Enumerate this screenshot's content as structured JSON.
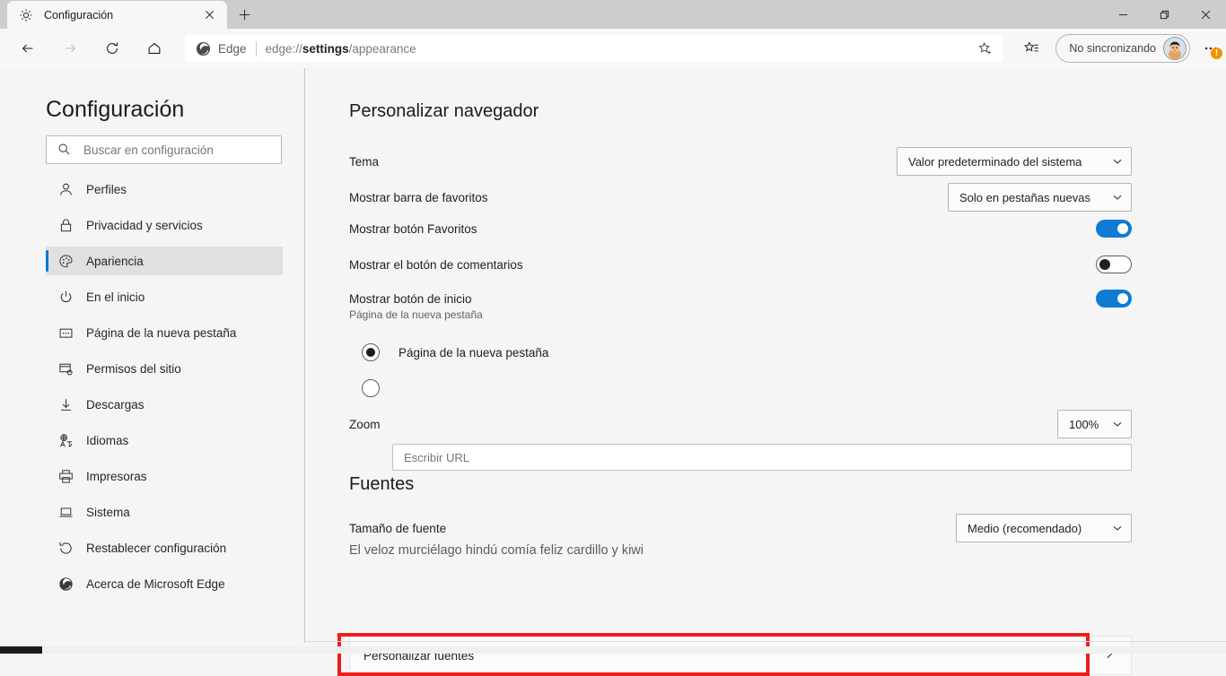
{
  "window": {
    "minimize_label": "Minimizar",
    "restore_label": "Restaurar",
    "close_label": "Cerrar"
  },
  "tabstrip": {
    "tab": {
      "title": "Configuración",
      "favicon": "gear-icon",
      "close_label": "×"
    },
    "new_tab_label": "+"
  },
  "toolbar": {
    "back_label": "Atrás",
    "forward_label": "Adelante",
    "refresh_label": "Actualizar",
    "home_label": "Inicio",
    "omnibox": {
      "site_label": "Edge",
      "url_prefix": "edge://",
      "url_bold": "settings",
      "url_suffix": "/appearance",
      "full_url": "edge://settings/appearance",
      "favorite_icon": "star-add-icon"
    },
    "collections_icon": "collections-icon",
    "profile": {
      "label": "No sincronizando",
      "avatar": "user-avatar"
    },
    "more": {
      "icon": "ellipsis-icon",
      "badge": "!"
    }
  },
  "sidebar": {
    "title": "Configuración",
    "search": {
      "placeholder": "Buscar en configuración",
      "value": "",
      "icon": "search-icon"
    },
    "items": [
      {
        "label": "Perfiles",
        "icon": "person-icon",
        "selected": false
      },
      {
        "label": "Privacidad y servicios",
        "icon": "lock-icon",
        "selected": false
      },
      {
        "label": "Apariencia",
        "icon": "palette-icon",
        "selected": true
      },
      {
        "label": "En el inicio",
        "icon": "power-icon",
        "selected": false
      },
      {
        "label": "Página de la nueva pestaña",
        "icon": "newtab-icon",
        "selected": false
      },
      {
        "label": "Permisos del sitio",
        "icon": "site-permissions-icon",
        "selected": false
      },
      {
        "label": "Descargas",
        "icon": "download-icon",
        "selected": false
      },
      {
        "label": "Idiomas",
        "icon": "language-icon",
        "selected": false
      },
      {
        "label": "Impresoras",
        "icon": "printer-icon",
        "selected": false
      },
      {
        "label": "Sistema",
        "icon": "laptop-icon",
        "selected": false
      },
      {
        "label": "Restablecer configuración",
        "icon": "reset-icon",
        "selected": false
      },
      {
        "label": "Acerca de Microsoft Edge",
        "icon": "edge-icon",
        "selected": false
      }
    ]
  },
  "main": {
    "section_customize": {
      "title": "Personalizar navegador",
      "theme": {
        "label": "Tema",
        "value": "Valor predeterminado del sistema"
      },
      "favorites_bar": {
        "label": "Mostrar barra de favoritos",
        "value": "Solo en pestañas nuevas"
      },
      "favorites_button": {
        "label": "Mostrar botón Favoritos",
        "state": "on"
      },
      "feedback_button": {
        "label": "Mostrar el botón de comentarios",
        "state": "off"
      },
      "home_button": {
        "label": "Mostrar botón de inicio",
        "sublabel": "Página de la nueva pestaña",
        "state": "on",
        "radio_newtab": {
          "label": "Página de la nueva pestaña",
          "checked": true
        },
        "radio_url": {
          "checked": false,
          "placeholder": "Escribir URL",
          "value": ""
        }
      },
      "zoom": {
        "label": "Zoom",
        "value": "100%"
      }
    },
    "section_fonts": {
      "title": "Fuentes",
      "font_size": {
        "label": "Tamaño de fuente",
        "value": "Medio (recomendado)"
      },
      "sample_text": "El veloz murciélago hindú comía feliz cardillo y kiwi",
      "customize_fonts": {
        "label": "Personalizar fuentes",
        "chevron": "chevron-right-icon"
      }
    }
  },
  "annotation": {
    "color": "#ee1d1d",
    "target": "Personalizar fuentes"
  },
  "colors": {
    "accent": "#0078d4",
    "toggle_on": "#0f7bd4",
    "badge": "#f29100",
    "highlight": "#ee1d1d"
  }
}
